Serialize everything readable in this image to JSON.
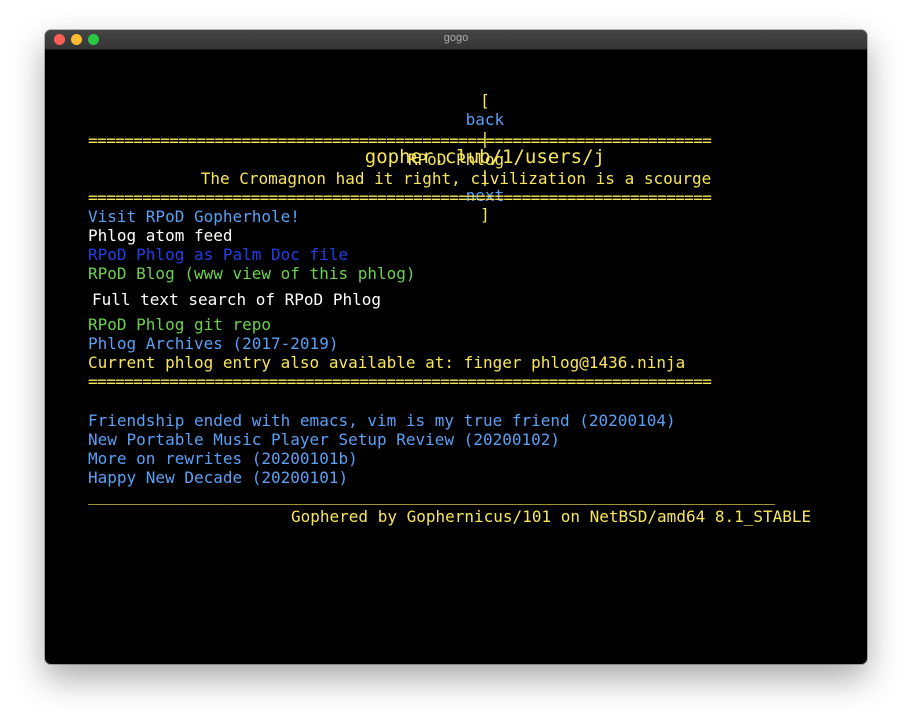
{
  "window": {
    "title": "gogo"
  },
  "nav": {
    "open_bracket": "[",
    "back": "back",
    "sep1": "|",
    "address": "gopher.club/1/users/j",
    "sep2": "|",
    "next": "next",
    "close_bracket": "]"
  },
  "header": {
    "rule": "=====================================================================",
    "title": "RPoD Phlog",
    "subtitle": "The Cromagnon had it right, civilization is a scourge"
  },
  "menu": {
    "gopherhole": "Visit RPoD Gopherhole!",
    "atom": "Phlog atom feed",
    "palm": "RPoD Phlog as Palm Doc file",
    "blog": "RPoD Blog (www view of this phlog)",
    "search": "Full text search of RPoD Phlog",
    "git": "RPoD Phlog git repo",
    "archives": "Phlog Archives (2017-2019)",
    "finger": "Current phlog entry also available at: finger phlog@1436.ninja"
  },
  "entries": [
    "Friendship ended with emacs, vim is my true friend (20200104)",
    "New Portable Music Player Setup Review (20200102)",
    "More on rewrites (20200101b)",
    "Happy New Decade (20200101)"
  ],
  "footer": {
    "underline": "____________________________________________________________________________",
    "text": "Gophered by Gophernicus/101 on NetBSD/amd64 8.1_STABLE"
  },
  "colors": {
    "background": "#000000",
    "info_text": "#f8e65a",
    "link": "#5aa0f5",
    "binary_link": "#2240e8",
    "web_link": "#6cd24e",
    "plain_text": "#ffffff"
  }
}
